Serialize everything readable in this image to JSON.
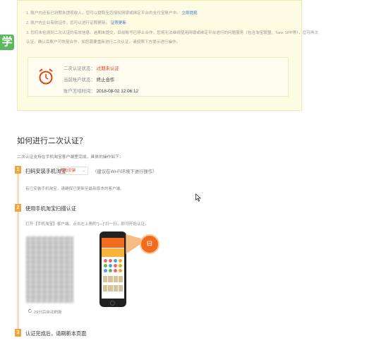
{
  "notice": {
    "line1": "1. 账户内还有已到期未提现收入，您可以提取至您授权网银或绑定平台的支付宝账户中。",
    "line1_link": "立即提现",
    "line2": "2. 账户内企业有效证件，您可以进行证照更新。",
    "line2_link": "证照更新",
    "line3": "3. 您们未检测到二次认证的有效信息，逾期未提交，目前账号已停止合作，您将无法继续使用网银或绑定平台进行的问题服务（包含淘宝联盟、Tanx SPP等），您可再次",
    "line4": "认证，确认后账户可恢复合作，如您需要重新进行二次认证，请按照下方提示进行操作。"
  },
  "badge": "学",
  "status": {
    "cert_label": "二次认证状态：",
    "cert_value": "过期未认证",
    "account_label": "当前账户状态：",
    "account_value": "终止合作",
    "time_label": "账户冻结时间：",
    "time_value": "2018-08-02 12:06:12"
  },
  "how": {
    "title": "如何进行二次认证？",
    "desc": "二次认证支持在手机淘宝客户端里完成，具体的操作如下："
  },
  "step1": {
    "num": "1",
    "title": "扫码安装手机淘宝",
    "dropdown": "扫码安装",
    "hint": "（建议在Wi-Fi环境下进行操作）",
    "sub": "有已安装手机淘宝，请确保已更新至最新版本的客户端。"
  },
  "step2": {
    "num": "2",
    "title": "使用手机淘宝扫描认证",
    "instr": "打开【手机淘宝】客户端，点击左上角的“[—]”扫一扫，即可开始认证。",
    "refresh": "29分后自动刷新"
  },
  "step3": {
    "num": "3",
    "title": "认证完成后，请刷新本页面"
  },
  "colors": {
    "accent": "#f0a53c",
    "alert": "#e0401c",
    "link": "#3c78c8",
    "notice_bg": "#fdfbe2"
  }
}
